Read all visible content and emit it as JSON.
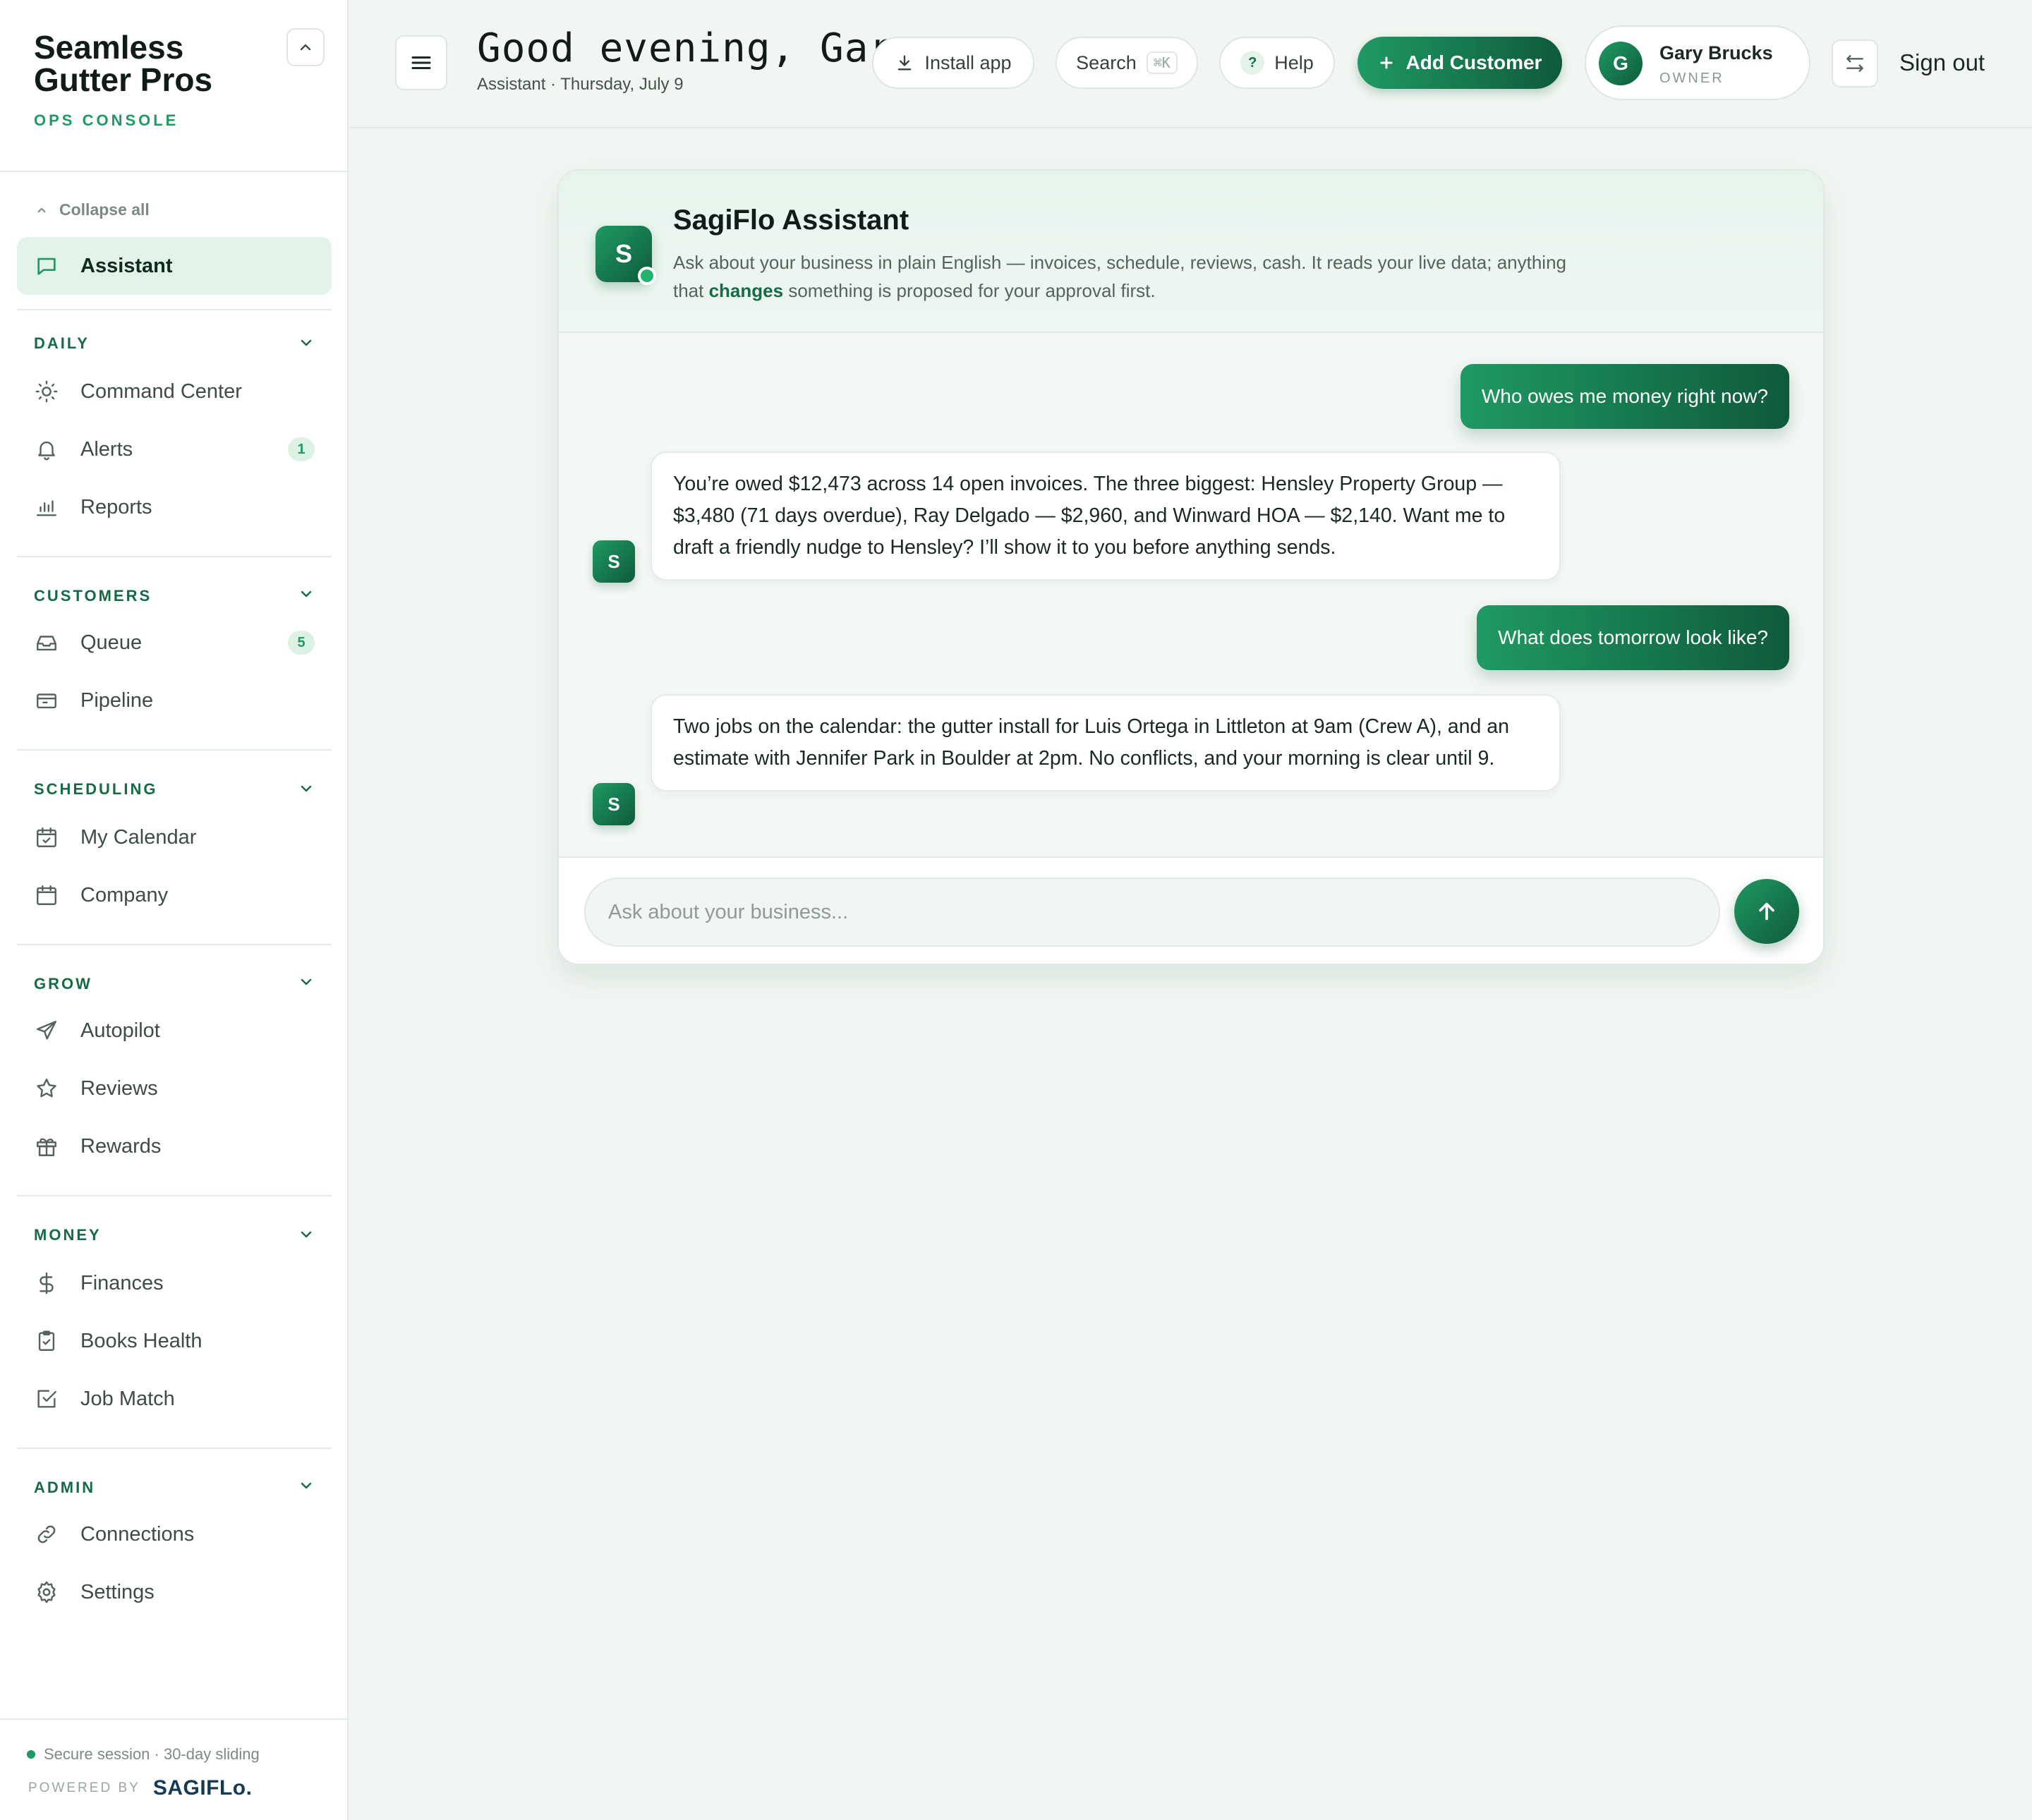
{
  "brand": {
    "name": "Seamless Gutter Pros",
    "subtitle": "OPS CONSOLE"
  },
  "sidebar": {
    "collapse_all": "Collapse all",
    "assistant": "Assistant",
    "sections": {
      "daily": {
        "label": "DAILY",
        "items": [
          {
            "label": "Command Center",
            "icon": "sun-icon"
          },
          {
            "label": "Alerts",
            "icon": "bell-icon",
            "badge": "1"
          },
          {
            "label": "Reports",
            "icon": "bar-chart-icon"
          }
        ]
      },
      "customers": {
        "label": "CUSTOMERS",
        "items": [
          {
            "label": "Queue",
            "icon": "inbox-icon",
            "badge": "5"
          },
          {
            "label": "Pipeline",
            "icon": "pipeline-icon"
          }
        ]
      },
      "scheduling": {
        "label": "SCHEDULING",
        "items": [
          {
            "label": "My Calendar",
            "icon": "calendar-check-icon"
          },
          {
            "label": "Company",
            "icon": "calendar-icon"
          }
        ]
      },
      "grow": {
        "label": "GROW",
        "items": [
          {
            "label": "Autopilot",
            "icon": "send-icon"
          },
          {
            "label": "Reviews",
            "icon": "star-icon"
          },
          {
            "label": "Rewards",
            "icon": "gift-icon"
          }
        ]
      },
      "money": {
        "label": "MONEY",
        "items": [
          {
            "label": "Finances",
            "icon": "dollar-icon"
          },
          {
            "label": "Books Health",
            "icon": "clipboard-check-icon"
          },
          {
            "label": "Job Match",
            "icon": "checkbox-icon"
          }
        ]
      },
      "admin": {
        "label": "ADMIN",
        "items": [
          {
            "label": "Connections",
            "icon": "link-icon"
          },
          {
            "label": "Settings",
            "icon": "gear-icon"
          }
        ]
      }
    },
    "footer": {
      "secure": "Secure session · 30-day sliding",
      "powered_by": "POWERED BY",
      "powered_logo": "SAGIFLo."
    }
  },
  "header": {
    "greeting": "Good evening, Gary",
    "subline": "Assistant · Thursday, July 9",
    "install": "Install app",
    "search": "Search",
    "search_kbd": "⌘K",
    "help": "Help",
    "add_customer": "Add Customer",
    "user": {
      "initial": "G",
      "name": "Gary Brucks",
      "role": "OWNER"
    },
    "sign_out": "Sign out"
  },
  "assistant": {
    "logo_initial": "S",
    "title": "SagiFlo Assistant",
    "desc_before": "Ask about your business in plain English — invoices, schedule, reviews, cash. It reads your live data; anything that ",
    "desc_bold": "changes",
    "desc_after": " something is proposed for your approval first.",
    "messages": [
      {
        "role": "user",
        "text": "Who owes me money right now?"
      },
      {
        "role": "bot",
        "text": "You’re owed $12,473 across 14 open invoices. The three biggest: Hensley Property Group — $3,480 (71 days overdue), Ray Delgado — $2,960, and Winward HOA — $2,140. Want me to draft a friendly nudge to Hensley? I’ll show it to you before anything sends."
      },
      {
        "role": "user",
        "text": "What does tomorrow look like?"
      },
      {
        "role": "bot",
        "text": "Two jobs on the calendar: the gutter install for Luis Ortega in Littleton at 9am (Crew A), and an estimate with Jennifer Park in Boulder at 2pm. No conflicts, and your morning is clear until 9."
      }
    ],
    "composer_placeholder": "Ask about your business..."
  },
  "colors": {
    "accent": "#1f9a63",
    "accent_dark": "#0f5a3b",
    "background": "#f1f6f2"
  }
}
